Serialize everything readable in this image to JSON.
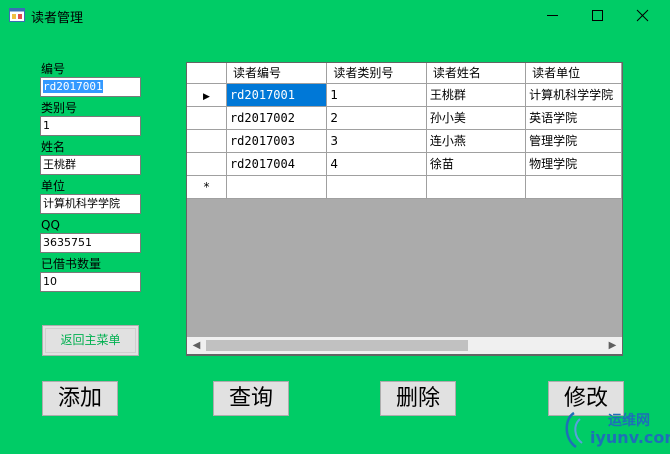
{
  "window": {
    "title": "读者管理",
    "background": "#00cc66"
  },
  "form": {
    "fields": [
      {
        "label": "编号",
        "value": "rd2017001"
      },
      {
        "label": "类别号",
        "value": "1"
      },
      {
        "label": "姓名",
        "value": "王桃群"
      },
      {
        "label": "单位",
        "value": "计算机科学学院"
      },
      {
        "label": "QQ",
        "value": "3635751"
      },
      {
        "label": "已借书数量",
        "value": "10"
      }
    ],
    "return_button": "返回主菜单"
  },
  "grid": {
    "columns": [
      "读者编号",
      "读者类别号",
      "读者姓名",
      "读者单位"
    ],
    "rows": [
      [
        "rd2017001",
        "1",
        "王桃群",
        "计算机科学学院"
      ],
      [
        "rd2017002",
        "2",
        "孙小美",
        "英语学院"
      ],
      [
        "rd2017003",
        "3",
        "连小燕",
        "管理学院"
      ],
      [
        "rd2017004",
        "4",
        "徐苗",
        "物理学院"
      ]
    ],
    "current_row_marker": "▶",
    "new_row_marker": "*"
  },
  "actions": {
    "add": "添加",
    "query": "查询",
    "delete": "删除",
    "modify": "修改"
  },
  "watermark": {
    "brand": "运维网",
    "site": "iyunv.com"
  }
}
